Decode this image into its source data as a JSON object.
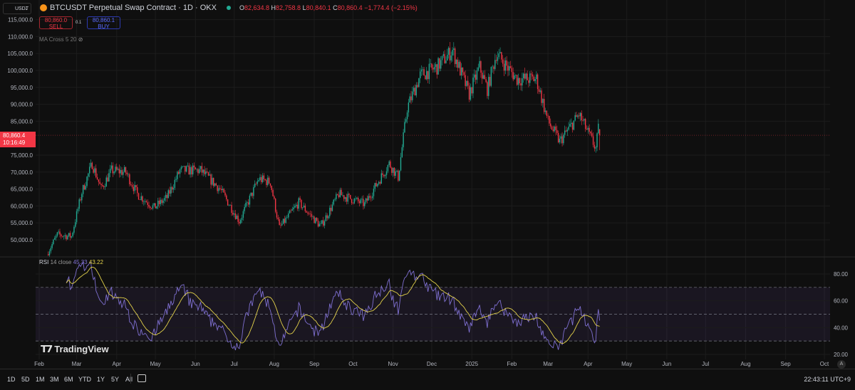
{
  "header": {
    "currency_select": "USDT",
    "symbol_title": "BTCUSDT Perpetual Swap Contract · 1D · OKX",
    "ohlc": {
      "o_label": "O",
      "o": "82,634.8",
      "h_label": "H",
      "h": "82,758.8",
      "l_label": "L",
      "l": "80,840.1",
      "c_label": "C",
      "c": "80,860.4",
      "change": "−1,774.4 (−2.15%)"
    },
    "sell": {
      "price": "80,860.0",
      "label": "SELL"
    },
    "buy": {
      "price": "80,860.1",
      "label": "BUY"
    },
    "qty": "0.1",
    "indicator": "MA Cross 5 20"
  },
  "current_price": {
    "price": "80,860.4",
    "countdown": "10:16:49"
  },
  "rsi_legend": {
    "name": "RSI",
    "params": "14 close",
    "value": "45.33",
    "ma_value": "43.22"
  },
  "logo": "TradingView",
  "toolbar": {
    "ranges": [
      "1D",
      "5D",
      "1M",
      "3M",
      "6M",
      "YTD",
      "1Y",
      "5Y",
      "All"
    ],
    "clock": "22:43:11 UTC+9",
    "timezone_btn": "A"
  },
  "colors": {
    "up": "#22ab94",
    "down": "#f23645",
    "rsi": "#7e6fd0",
    "rsi_ma": "#e3d24a",
    "bg": "#0f0f0f"
  },
  "chart_data": {
    "type": "candlestick",
    "title": "BTCUSDT Perpetual Swap Contract · 1D · OKX",
    "price_ticks": [
      "115,000.0",
      "110,000.0",
      "105,000.0",
      "100,000.0",
      "95,000.0",
      "90,000.0",
      "85,000.0",
      "75,000.0",
      "70,000.0",
      "65,000.0",
      "60,000.0",
      "55,000.0",
      "50,000.0"
    ],
    "price_tick_values": [
      115000,
      110000,
      105000,
      100000,
      95000,
      90000,
      85000,
      75000,
      70000,
      65000,
      60000,
      55000,
      50000
    ],
    "ylim": [
      45000,
      118000
    ],
    "rsi_ticks": [
      "80.00",
      "60.00",
      "40.00",
      "20.00"
    ],
    "rsi_tick_values": [
      80,
      60,
      40,
      20
    ],
    "rsi_bands": [
      70,
      50,
      30
    ],
    "x_labels": [
      "Feb",
      "Mar",
      "Apr",
      "May",
      "Jun",
      "Jul",
      "Aug",
      "Sep",
      "Oct",
      "Nov",
      "Dec",
      "2025",
      "Feb",
      "Mar",
      "Apr",
      "May",
      "Jun",
      "Jul",
      "Aug",
      "Sep",
      "Oct"
    ],
    "x_label_dates": [
      "2024-02-01",
      "2024-03-01",
      "2024-04-01",
      "2024-05-01",
      "2024-06-01",
      "2024-07-01",
      "2024-08-01",
      "2024-09-01",
      "2024-10-01",
      "2024-11-01",
      "2024-12-01",
      "2025-01-01",
      "2025-02-01",
      "2025-03-01",
      "2025-04-01",
      "2025-05-01",
      "2025-06-01",
      "2025-07-01",
      "2025-08-01",
      "2025-09-01",
      "2025-10-01"
    ],
    "close_anchors": [
      [
        "2024-02-08",
        46500
      ],
      [
        "2024-02-15",
        51500
      ],
      [
        "2024-02-26",
        51000
      ],
      [
        "2024-03-05",
        64000
      ],
      [
        "2024-03-13",
        72500
      ],
      [
        "2024-03-20",
        65000
      ],
      [
        "2024-03-28",
        70500
      ],
      [
        "2024-04-08",
        70000
      ],
      [
        "2024-04-17",
        63500
      ],
      [
        "2024-04-30",
        59500
      ],
      [
        "2024-05-10",
        62500
      ],
      [
        "2024-05-20",
        70500
      ],
      [
        "2024-06-05",
        70500
      ],
      [
        "2024-06-20",
        65000
      ],
      [
        "2024-07-05",
        55500
      ],
      [
        "2024-07-20",
        68000
      ],
      [
        "2024-07-29",
        67000
      ],
      [
        "2024-08-05",
        53500
      ],
      [
        "2024-08-20",
        61000
      ],
      [
        "2024-09-06",
        54000
      ],
      [
        "2024-09-20",
        63500
      ],
      [
        "2024-10-10",
        60500
      ],
      [
        "2024-10-29",
        72500
      ],
      [
        "2024-11-05",
        68500
      ],
      [
        "2024-11-12",
        89000
      ],
      [
        "2024-11-22",
        98500
      ],
      [
        "2024-12-05",
        101000
      ],
      [
        "2024-12-17",
        106000
      ],
      [
        "2024-12-30",
        93000
      ],
      [
        "2025-01-07",
        101000
      ],
      [
        "2025-01-13",
        94500
      ],
      [
        "2025-01-20",
        105000
      ],
      [
        "2025-02-05",
        97500
      ],
      [
        "2025-02-20",
        97500
      ],
      [
        "2025-03-01",
        85000
      ],
      [
        "2025-03-10",
        79000
      ],
      [
        "2025-03-25",
        87000
      ],
      [
        "2025-04-07",
        77000
      ],
      [
        "2025-04-09",
        82600
      ],
      [
        "2025-04-10",
        80860.4
      ]
    ],
    "last_candle": {
      "open": 82634.8,
      "high": 82758.8,
      "low": 80840.1,
      "close": 80860.4
    }
  }
}
